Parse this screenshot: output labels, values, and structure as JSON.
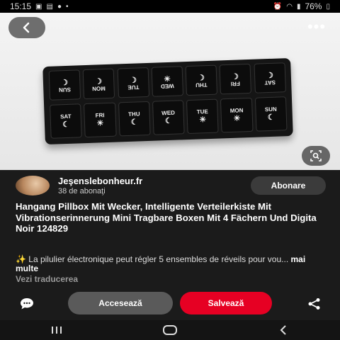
{
  "status_bar": {
    "time": "15:15",
    "battery": "76%",
    "icons": [
      "gallery-icon",
      "image-icon",
      "pinterest-icon",
      "more-dots-icon",
      "alarm-icon",
      "wifi-icon",
      "signal-icon",
      "battery-icon"
    ]
  },
  "pillbox": {
    "top_row": [
      "SUN",
      "MON",
      "TUE",
      "WED",
      "THU",
      "FRI",
      "SAT"
    ],
    "top_icons": [
      "moon",
      "moon",
      "moon",
      "sun",
      "moon",
      "moon",
      "moon"
    ],
    "bottom_row": [
      "SAT",
      "FRI",
      "THU",
      "WED",
      "TUE",
      "MON",
      "SUN"
    ],
    "bottom_icons": [
      "moon",
      "sun",
      "moon",
      "moon",
      "sun",
      "sun",
      "moon"
    ]
  },
  "author": {
    "name": "Jeşenslebonheur.fr",
    "followers": "38 de abonaţi",
    "follow_label": "Abonare"
  },
  "pin": {
    "title": "Hangang Pillbox Mit Wecker, Intelligente Verteilerkiste Mit Vibrationserinnerung Mini Tragbare Boxen Mit 4 Fächern Und Digita Noir 124829",
    "description": "✨ La pilulier électronique peut régler 5 ensembles de réveils pour vou...",
    "more_label": "mai multe",
    "translate_label": "Vezi traducerea"
  },
  "actions": {
    "access_label": "Accesează",
    "save_label": "Salvează"
  },
  "colors": {
    "save": "#e60023",
    "access": "#5a5a5a",
    "background": "#1b1b1b"
  }
}
